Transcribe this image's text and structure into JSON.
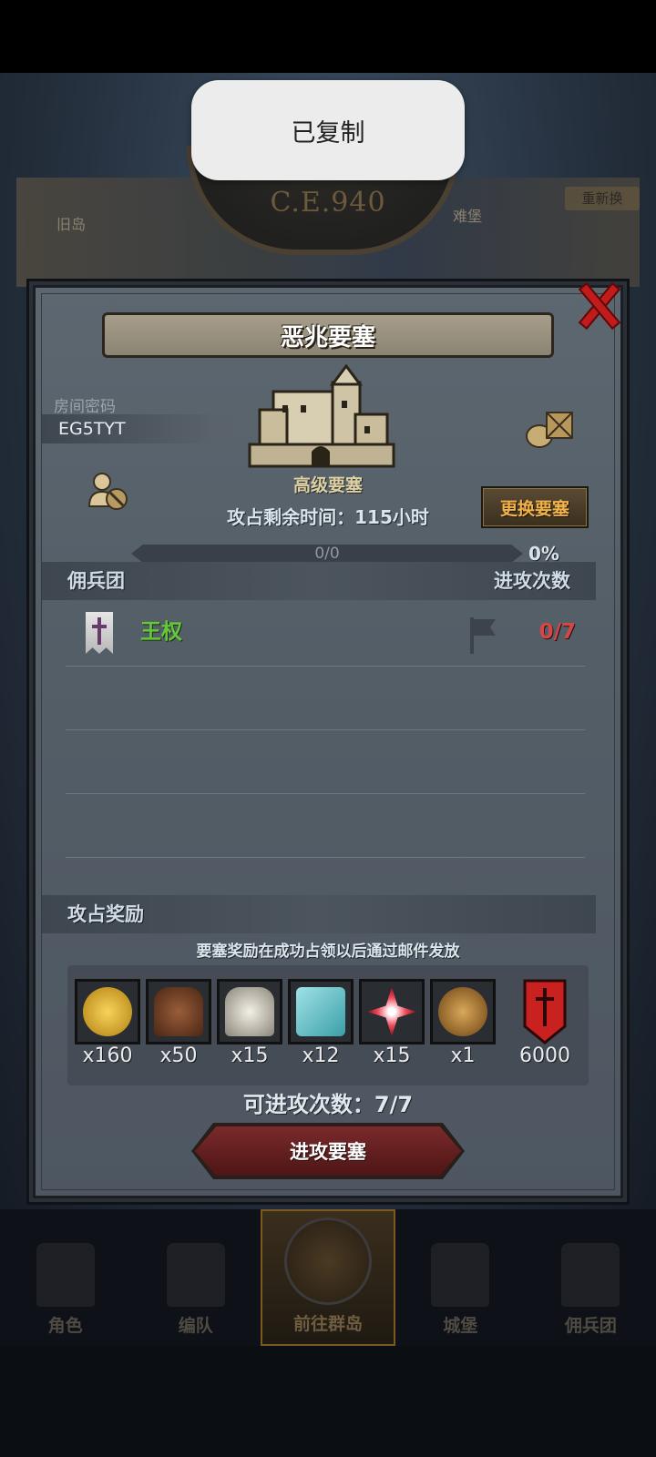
{
  "toast": {
    "text": "已复制"
  },
  "background": {
    "year": "C.E.940",
    "left_label": "旧岛",
    "right_label": "难堡",
    "right_button": "重新换"
  },
  "dialog": {
    "title": "恶兆要塞",
    "room_label": "房间密码",
    "room_code": "EG5TYT",
    "fort_type": "高级要塞",
    "remaining_time": "攻占剩余时间：115小时",
    "change_button": "更换要塞",
    "progress": {
      "text": "0/0",
      "percent_label": "0%",
      "fraction": 0
    },
    "merc_section": {
      "left": "佣兵团",
      "right": "进攻次数"
    },
    "mercenaries": [
      {
        "name": "王权",
        "count": "0/7",
        "icon": "banner-cross-icon"
      }
    ],
    "reward_section": {
      "left": "攻占奖励"
    },
    "reward_note": "要塞奖励在成功占领以后通过邮件发放",
    "rewards": [
      {
        "icon": "gold-coin-icon",
        "qty": "x160"
      },
      {
        "icon": "brown-horse-icon",
        "qty": "x50"
      },
      {
        "icon": "white-horse-icon",
        "qty": "x15"
      },
      {
        "icon": "cloth-roll-icon",
        "qty": "x12"
      },
      {
        "icon": "red-star-icon",
        "qty": "x15"
      },
      {
        "icon": "helmet-medal-icon",
        "qty": "x1"
      },
      {
        "icon": "red-sword-banner-icon",
        "qty": "6000"
      }
    ],
    "attacks_left": "可进攻次数：7/7",
    "attack_button": "进攻要塞"
  },
  "bottom_nav": [
    {
      "label": "角色",
      "active": false
    },
    {
      "label": "编队",
      "active": false
    },
    {
      "label": "前往群岛",
      "active": true
    },
    {
      "label": "城堡",
      "active": false
    },
    {
      "label": "佣兵团",
      "active": false
    }
  ],
  "colors": {
    "merc_name": "#64c93a",
    "attack_count": "#d44747",
    "change_button_text": "#f1b24a",
    "close_x": "#c21b1b"
  }
}
